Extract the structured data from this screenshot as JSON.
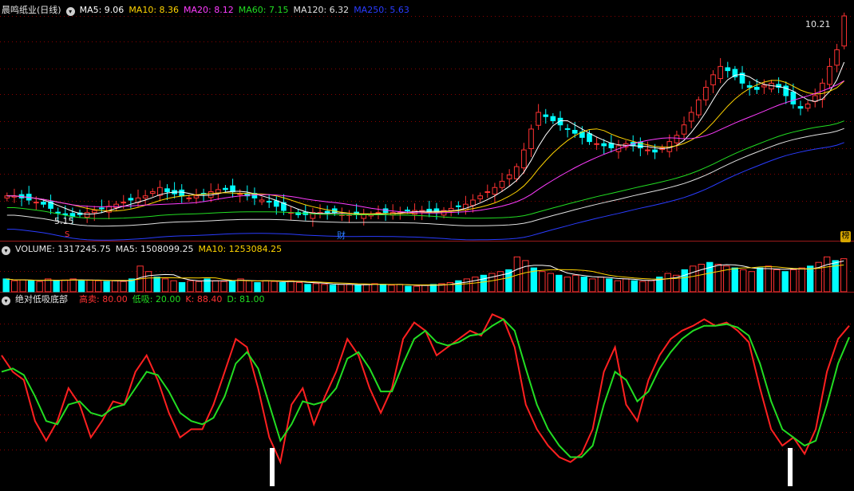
{
  "stock_name": "晨鸣纸业(日线)",
  "indicator_icon": "chevron-down-icon",
  "price_panel": {
    "mas": [
      {
        "label": "MA5: 9.06",
        "color": "#ffffff"
      },
      {
        "label": "MA10: 8.36",
        "color": "#ffd400"
      },
      {
        "label": "MA20: 8.12",
        "color": "#ff3cff"
      },
      {
        "label": "MA60: 7.15",
        "color": "#22dd22"
      },
      {
        "label": "MA120: 6.32",
        "color": "#e0e0e0"
      },
      {
        "label": "MA250: 5.63",
        "color": "#2a3cff"
      }
    ],
    "high_label": "10.21",
    "low_label": "5.15",
    "mark_s": "S",
    "mark_cai": "财",
    "mark_bang": "榜"
  },
  "volume_panel": {
    "title": "VOLUME: 1317245.75",
    "ma5": "MA5: 1508099.25",
    "ma10": "MA10: 1253084.25"
  },
  "indicator_panel": {
    "title": "绝对低吸底部",
    "high_sell": "高卖: 80.00",
    "low_buy": "低吸: 20.00",
    "k": "K: 88.40",
    "d": "D: 81.00"
  },
  "colors": {
    "up": "#ff3232",
    "down": "#00ffff",
    "k_line": "#ff2020",
    "d_line": "#22dd22",
    "grid": "#8b0000"
  },
  "chart_data": [
    {
      "type": "candlestick",
      "series_names": [
        "MA5",
        "MA10",
        "MA20",
        "MA60",
        "MA120",
        "MA250"
      ],
      "price_range": [
        5.15,
        10.21
      ],
      "close_approx": [
        5.9,
        5.9,
        5.85,
        5.8,
        5.75,
        5.7,
        5.6,
        5.5,
        5.45,
        5.4,
        5.45,
        5.5,
        5.55,
        5.6,
        5.65,
        5.7,
        5.75,
        5.8,
        5.85,
        5.9,
        6.0,
        6.1,
        6.0,
        5.95,
        5.9,
        5.85,
        5.9,
        5.95,
        6.0,
        6.05,
        6.05,
        6.0,
        5.95,
        5.9,
        5.85,
        5.8,
        5.75,
        5.65,
        5.55,
        5.5,
        5.45,
        5.45,
        5.5,
        5.5,
        5.5,
        5.5,
        5.45,
        5.45,
        5.45,
        5.45,
        5.45,
        5.5,
        5.5,
        5.5,
        5.5,
        5.55,
        5.55,
        5.55,
        5.5,
        5.5,
        5.55,
        5.6,
        5.65,
        5.7,
        5.8,
        5.9,
        6.0,
        6.1,
        6.25,
        6.4,
        6.6,
        7.0,
        7.5,
        7.9,
        7.8,
        7.7,
        7.6,
        7.5,
        7.4,
        7.3,
        7.2,
        7.15,
        7.1,
        7.05,
        7.1,
        7.15,
        7.1,
        7.05,
        7.0,
        6.95,
        7.05,
        7.2,
        7.35,
        7.6,
        7.9,
        8.2,
        8.5,
        8.8,
        9.0,
        8.9,
        8.75,
        8.6,
        8.5,
        8.45,
        8.55,
        8.6,
        8.5,
        8.3,
        8.1,
        8.0,
        8.1,
        8.3,
        8.6,
        9.0,
        9.4,
        10.21
      ]
    },
    {
      "type": "bar",
      "series_names": [
        "MA5",
        "MA10"
      ],
      "last_volume": 1317245.75,
      "ma5": 1508099.25,
      "ma10": 1253084.25,
      "rel_values": [
        0.35,
        0.3,
        0.32,
        0.3,
        0.28,
        0.35,
        0.3,
        0.32,
        0.35,
        0.3,
        0.32,
        0.3,
        0.28,
        0.3,
        0.28,
        0.35,
        0.7,
        0.55,
        0.4,
        0.35,
        0.3,
        0.25,
        0.3,
        0.28,
        0.35,
        0.3,
        0.28,
        0.3,
        0.35,
        0.3,
        0.25,
        0.3,
        0.28,
        0.25,
        0.3,
        0.25,
        0.2,
        0.22,
        0.2,
        0.18,
        0.2,
        0.2,
        0.18,
        0.2,
        0.22,
        0.2,
        0.18,
        0.2,
        0.15,
        0.15,
        0.18,
        0.2,
        0.22,
        0.25,
        0.3,
        0.35,
        0.4,
        0.45,
        0.5,
        0.55,
        0.6,
        0.95,
        0.85,
        0.65,
        0.55,
        0.5,
        0.45,
        0.4,
        0.45,
        0.4,
        0.35,
        0.4,
        0.35,
        0.3,
        0.35,
        0.3,
        0.28,
        0.3,
        0.4,
        0.5,
        0.45,
        0.6,
        0.7,
        0.75,
        0.8,
        0.75,
        0.7,
        0.65,
        0.6,
        0.55,
        0.65,
        0.7,
        0.6,
        0.55,
        0.6,
        0.65,
        0.7,
        0.8,
        0.95,
        0.85,
        0.9
      ]
    },
    {
      "type": "line",
      "series_names": [
        "K",
        "D"
      ],
      "ylim": [
        0,
        100
      ],
      "k": [
        70,
        60,
        55,
        30,
        18,
        30,
        50,
        40,
        20,
        30,
        42,
        40,
        60,
        70,
        55,
        35,
        20,
        25,
        25,
        40,
        60,
        80,
        75,
        50,
        20,
        5,
        40,
        50,
        28,
        45,
        60,
        80,
        70,
        50,
        35,
        50,
        80,
        90,
        85,
        70,
        75,
        80,
        85,
        82,
        95,
        92,
        75,
        40,
        25,
        15,
        8,
        5,
        10,
        25,
        60,
        75,
        40,
        30,
        55,
        70,
        80,
        85,
        88,
        92,
        88,
        90,
        85,
        78,
        50,
        25,
        15,
        20,
        10,
        25,
        60,
        80,
        88
      ],
      "d": [
        60,
        62,
        58,
        45,
        30,
        28,
        40,
        42,
        35,
        33,
        38,
        40,
        50,
        60,
        58,
        48,
        35,
        30,
        28,
        32,
        45,
        65,
        72,
        62,
        40,
        18,
        28,
        42,
        40,
        42,
        50,
        68,
        72,
        62,
        48,
        48,
        65,
        80,
        85,
        78,
        76,
        78,
        82,
        83,
        88,
        92,
        85,
        62,
        40,
        25,
        15,
        8,
        8,
        15,
        40,
        60,
        55,
        42,
        48,
        62,
        72,
        80,
        85,
        88,
        88,
        89,
        87,
        82,
        65,
        42,
        25,
        20,
        15,
        18,
        40,
        65,
        81
      ]
    }
  ]
}
